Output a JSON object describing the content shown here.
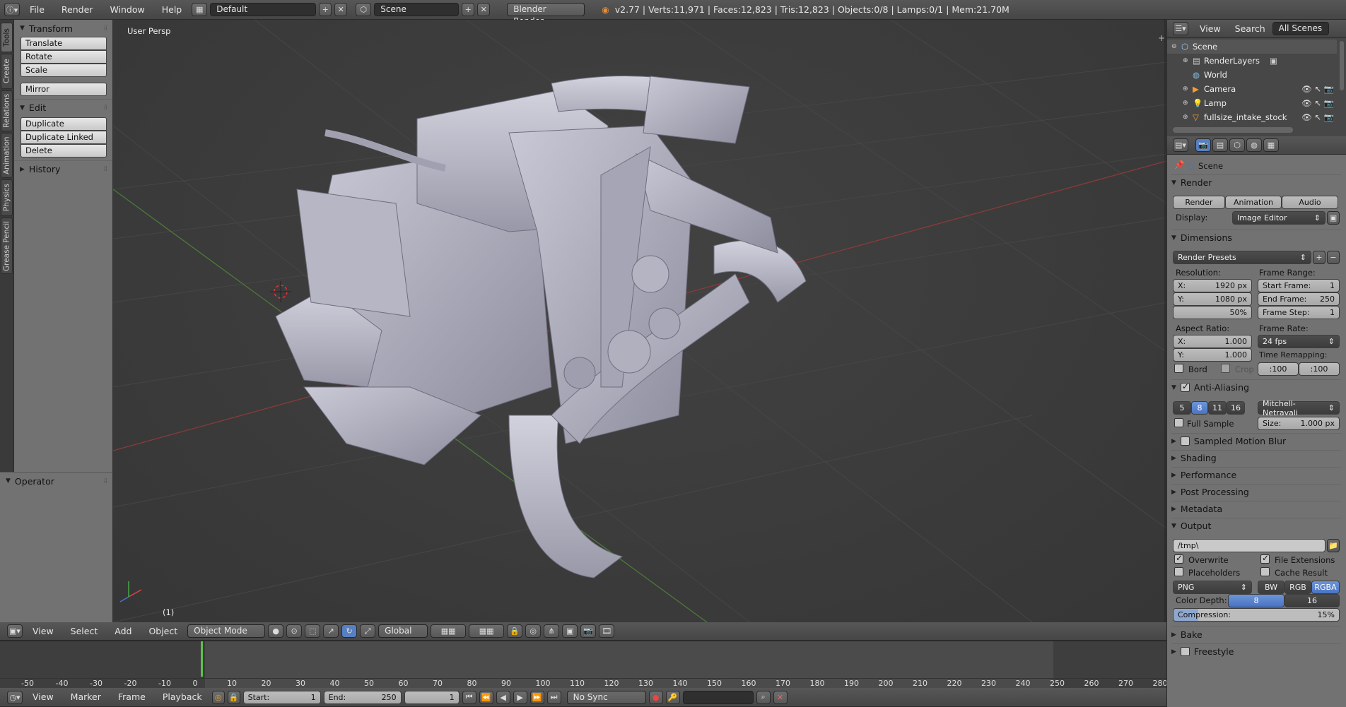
{
  "topbar": {
    "menus": [
      "File",
      "Render",
      "Window",
      "Help"
    ],
    "layout": "Default",
    "scene": "Scene",
    "engine": "Blender Render",
    "stats": "v2.77 | Verts:11,971 | Faces:12,823 | Tris:12,823 | Objects:0/8 | Lamps:0/1 | Mem:21.70M"
  },
  "tabs": [
    "Tools",
    "Create",
    "Relations",
    "Animation",
    "Physics",
    "Grease Pencil"
  ],
  "toolshelf": {
    "transform": "Transform",
    "transform_items": [
      "Translate",
      "Rotate",
      "Scale"
    ],
    "mirror": "Mirror",
    "edit": "Edit",
    "edit_items": [
      "Duplicate",
      "Duplicate Linked",
      "Delete"
    ],
    "history": "History",
    "operator": "Operator"
  },
  "viewport": {
    "label": "User Persp",
    "frame": "(1)"
  },
  "vphead": {
    "menus": [
      "View",
      "Select",
      "Add",
      "Object"
    ],
    "mode": "Object Mode",
    "orientation": "Global"
  },
  "timeline": {
    "ticks": [
      "-50",
      "-40",
      "-30",
      "-20",
      "-10",
      "0",
      "10",
      "20",
      "30",
      "40",
      "50",
      "60",
      "70",
      "80",
      "90",
      "100",
      "110",
      "120",
      "130",
      "140",
      "150",
      "160",
      "170",
      "180",
      "190",
      "200",
      "210",
      "220",
      "230",
      "240",
      "250",
      "260",
      "270",
      "280"
    ]
  },
  "tlbar": {
    "menus": [
      "View",
      "Marker",
      "Frame",
      "Playback"
    ],
    "start_label": "Start:",
    "start": "1",
    "end_label": "End:",
    "end": "250",
    "current": "1",
    "sync": "No Sync"
  },
  "outliner": {
    "menus": [
      "View",
      "Search"
    ],
    "filter": "All Scenes",
    "items": [
      "Scene",
      "RenderLayers",
      "World",
      "Camera",
      "Lamp",
      "fullsize_intake_stock"
    ]
  },
  "props": {
    "context": "Scene",
    "render": "Render",
    "render_btn": "Render",
    "animation_btn": "Animation",
    "audio_btn": "Audio",
    "display_label": "Display:",
    "display": "Image Editor",
    "dimensions": "Dimensions",
    "presets": "Render Presets",
    "resolution": "Resolution:",
    "res_x_label": "X:",
    "res_x": "1920 px",
    "res_y_label": "Y:",
    "res_y": "1080 px",
    "res_pct": "50%",
    "frame_range": "Frame Range:",
    "start_label": "Start Frame:",
    "start": "1",
    "end_label": "End Frame:",
    "end": "250",
    "step_label": "Frame Step:",
    "step": "1",
    "aspect": "Aspect Ratio:",
    "asp_x_label": "X:",
    "asp_x": "1.000",
    "asp_y_label": "Y:",
    "asp_y": "1.000",
    "frame_rate": "Frame Rate:",
    "fps": "24 fps",
    "remap": "Time Remapping:",
    "remap_old": ":100",
    "remap_new": ":100",
    "bord": "Bord",
    "crop": "Crop",
    "aa": "Anti-Aliasing",
    "aa_opts": [
      "5",
      "8",
      "11",
      "16"
    ],
    "filter": "Mitchell-Netravali",
    "full_sample": "Full Sample",
    "size_label": "Size:",
    "size": "1.000 px",
    "sections": [
      "Sampled Motion Blur",
      "Shading",
      "Performance",
      "Post Processing",
      "Metadata"
    ],
    "output": "Output",
    "path": "/tmp\\",
    "overwrite": "Overwrite",
    "file_ext": "File Extensions",
    "placeholders": "Placeholders",
    "cache": "Cache Result",
    "format": "PNG",
    "bw": "BW",
    "rgb": "RGB",
    "rgba": "RGBA",
    "depth_label": "Color Depth:",
    "depth_8": "8",
    "depth_16": "16",
    "compression_label": "Compression:",
    "compression": "15%",
    "bake": "Bake",
    "freestyle": "Freestyle"
  }
}
